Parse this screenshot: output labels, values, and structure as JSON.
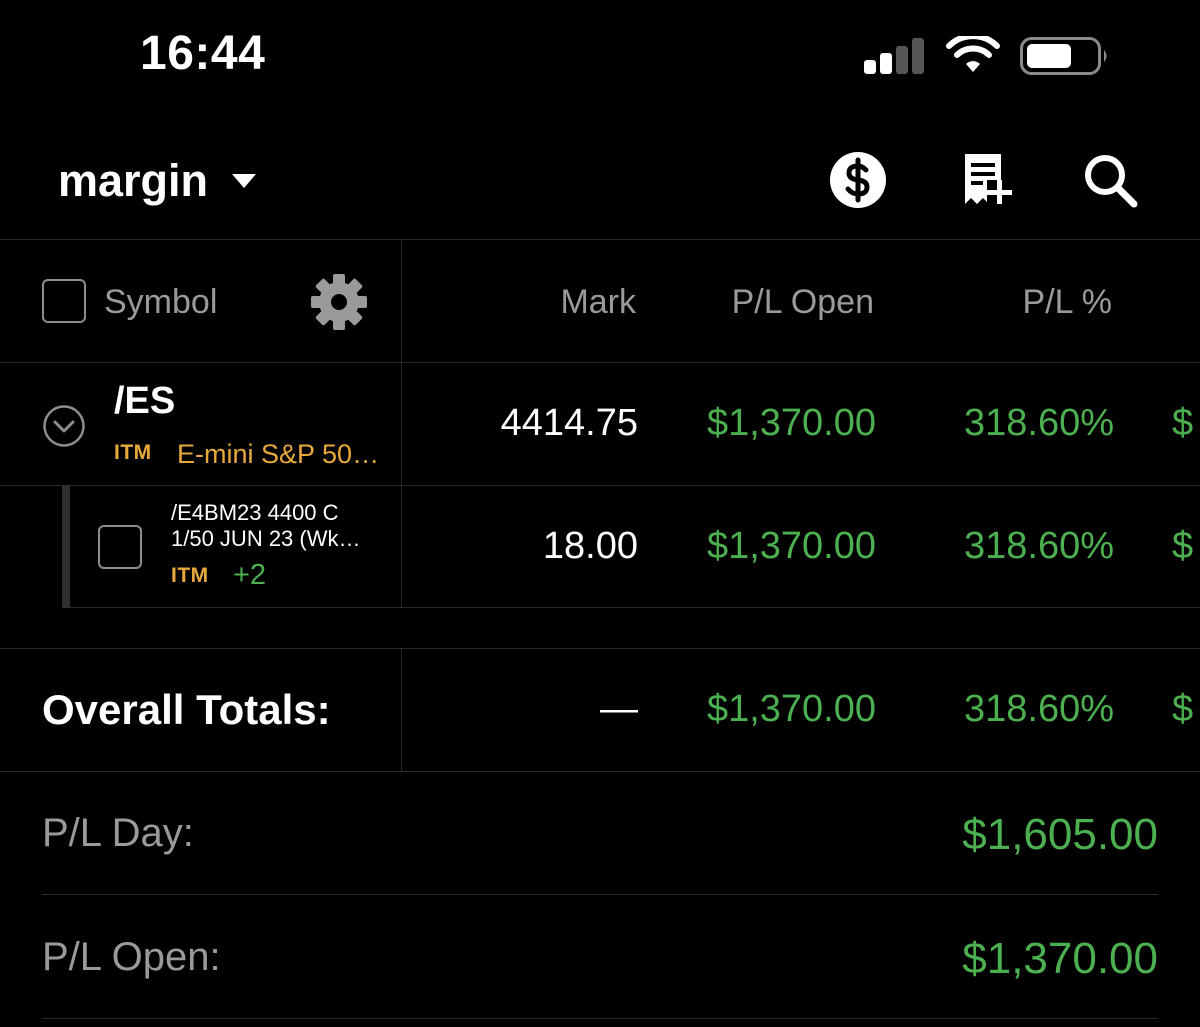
{
  "status_bar": {
    "time": "16:44"
  },
  "header": {
    "account": "margin"
  },
  "columns": {
    "symbol": "Symbol",
    "mark": "Mark",
    "pl_open": "P/L Open",
    "pl_percent": "P/L %",
    "overflow": "$"
  },
  "position": {
    "symbol": "/ES",
    "badge": "ITM",
    "description": "E-mini S&P 50…",
    "mark": "4414.75",
    "pl_open": "$1,370.00",
    "pl_percent": "318.60%",
    "overflow": "$",
    "leg": {
      "line1": "/E4BM23 4400 C",
      "line2": "1/50 JUN 23 (Wk…",
      "badge": "ITM",
      "extra": "+2",
      "mark": "18.00",
      "pl_open": "$1,370.00",
      "pl_percent": "318.60%",
      "overflow": "$"
    }
  },
  "totals": {
    "label": "Overall Totals:",
    "mark": "—",
    "pl_open": "$1,370.00",
    "pl_percent": "318.60%",
    "overflow": "$"
  },
  "summary": [
    {
      "label": "P/L Day:",
      "value": "$1,605.00"
    },
    {
      "label": "P/L Open:",
      "value": "$1,370.00"
    }
  ],
  "colors": {
    "green": "#4caf50",
    "itm": "#e8a93b",
    "muted": "#9a9a9a",
    "background": "#000000"
  }
}
